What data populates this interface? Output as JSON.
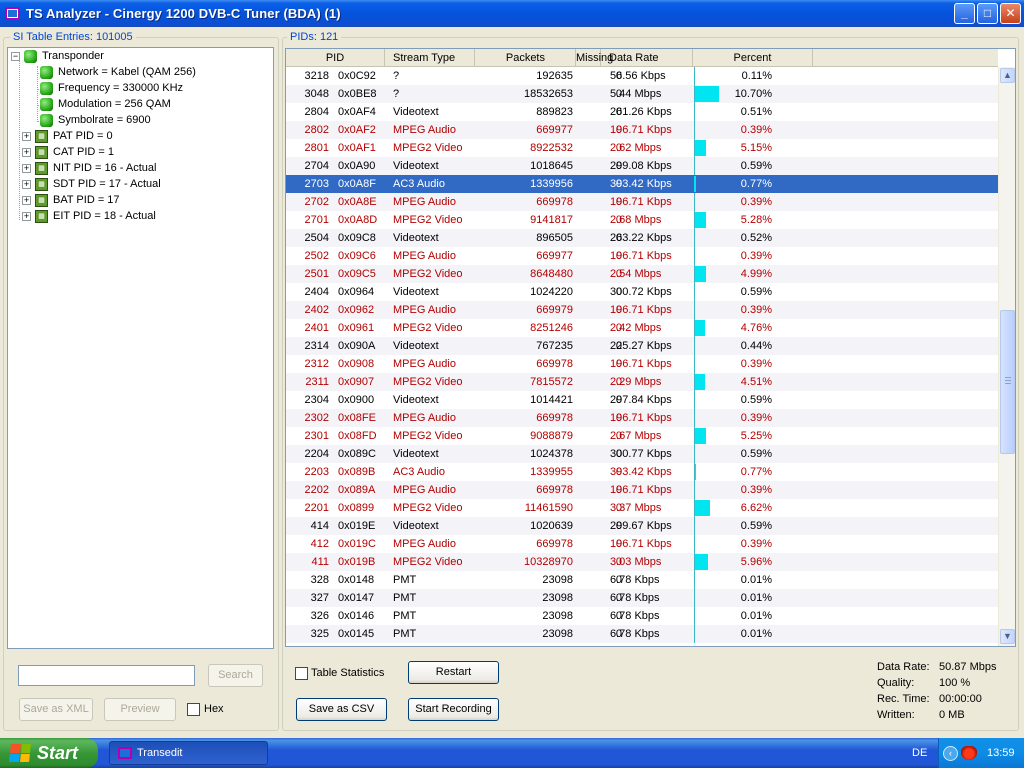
{
  "window": {
    "title": "TS Analyzer - Cinergy 1200 DVB-C Tuner (BDA) (1)",
    "buttons": {
      "minimize": "_",
      "maximize": "□",
      "close": "✕"
    }
  },
  "si_table": {
    "label": "SI Table Entries: 101005",
    "tree": {
      "root": "Transponder",
      "root_children": [
        "Network = Kabel (QAM 256)",
        "Frequency = 330000 KHz",
        "Modulation = 256 QAM",
        "Symbolrate = 6900"
      ],
      "tables": [
        "PAT PID = 0",
        "CAT PID = 1",
        "NIT PID = 16 - Actual",
        "SDT PID = 17 - Actual",
        "BAT PID = 17",
        "EIT PID = 18 - Actual"
      ]
    }
  },
  "pids": {
    "label": "PIDs: 121",
    "columns": [
      "PID",
      "Stream Type",
      "Packets",
      "Missing",
      "Data Rate",
      "Percent"
    ],
    "rows": [
      {
        "pid": "3218",
        "hex": "0x0C92",
        "type": "?",
        "packets": "192635",
        "missing": "0",
        "rate": "56.56 Kbps",
        "percent": "0.11%",
        "bar": 0.11,
        "red": false
      },
      {
        "pid": "3048",
        "hex": "0x0BE8",
        "type": "?",
        "packets": "18532653",
        "missing": "0",
        "rate": "5.44 Mbps",
        "percent": "10.70%",
        "bar": 10.7,
        "red": false
      },
      {
        "pid": "2804",
        "hex": "0x0AF4",
        "type": "Videotext",
        "packets": "889823",
        "missing": "0",
        "rate": "261.26 Kbps",
        "percent": "0.51%",
        "bar": 0.51,
        "red": false
      },
      {
        "pid": "2802",
        "hex": "0x0AF2",
        "type": "MPEG Audio",
        "packets": "669977",
        "missing": "0",
        "rate": "196.71 Kbps",
        "percent": "0.39%",
        "bar": 0.39,
        "red": true
      },
      {
        "pid": "2801",
        "hex": "0x0AF1",
        "type": "MPEG2 Video",
        "packets": "8922532",
        "missing": "0",
        "rate": "2.62 Mbps",
        "percent": "5.15%",
        "bar": 5.15,
        "red": true
      },
      {
        "pid": "2704",
        "hex": "0x0A90",
        "type": "Videotext",
        "packets": "1018645",
        "missing": "0",
        "rate": "299.08 Kbps",
        "percent": "0.59%",
        "bar": 0.59,
        "red": false
      },
      {
        "pid": "2703",
        "hex": "0x0A8F",
        "type": "AC3 Audio",
        "packets": "1339956",
        "missing": "0",
        "rate": "393.42 Kbps",
        "percent": "0.77%",
        "bar": 0.77,
        "red": true,
        "selected": true
      },
      {
        "pid": "2702",
        "hex": "0x0A8E",
        "type": "MPEG Audio",
        "packets": "669978",
        "missing": "0",
        "rate": "196.71 Kbps",
        "percent": "0.39%",
        "bar": 0.39,
        "red": true
      },
      {
        "pid": "2701",
        "hex": "0x0A8D",
        "type": "MPEG2 Video",
        "packets": "9141817",
        "missing": "0",
        "rate": "2.68 Mbps",
        "percent": "5.28%",
        "bar": 5.28,
        "red": true
      },
      {
        "pid": "2504",
        "hex": "0x09C8",
        "type": "Videotext",
        "packets": "896505",
        "missing": "0",
        "rate": "263.22 Kbps",
        "percent": "0.52%",
        "bar": 0.52,
        "red": false
      },
      {
        "pid": "2502",
        "hex": "0x09C6",
        "type": "MPEG Audio",
        "packets": "669977",
        "missing": "0",
        "rate": "196.71 Kbps",
        "percent": "0.39%",
        "bar": 0.39,
        "red": true
      },
      {
        "pid": "2501",
        "hex": "0x09C5",
        "type": "MPEG2 Video",
        "packets": "8648480",
        "missing": "0",
        "rate": "2.54 Mbps",
        "percent": "4.99%",
        "bar": 4.99,
        "red": true
      },
      {
        "pid": "2404",
        "hex": "0x0964",
        "type": "Videotext",
        "packets": "1024220",
        "missing": "0",
        "rate": "300.72 Kbps",
        "percent": "0.59%",
        "bar": 0.59,
        "red": false
      },
      {
        "pid": "2402",
        "hex": "0x0962",
        "type": "MPEG Audio",
        "packets": "669979",
        "missing": "0",
        "rate": "196.71 Kbps",
        "percent": "0.39%",
        "bar": 0.39,
        "red": true
      },
      {
        "pid": "2401",
        "hex": "0x0961",
        "type": "MPEG2 Video",
        "packets": "8251246",
        "missing": "0",
        "rate": "2.42 Mbps",
        "percent": "4.76%",
        "bar": 4.76,
        "red": true
      },
      {
        "pid": "2314",
        "hex": "0x090A",
        "type": "Videotext",
        "packets": "767235",
        "missing": "0",
        "rate": "225.27 Kbps",
        "percent": "0.44%",
        "bar": 0.44,
        "red": false
      },
      {
        "pid": "2312",
        "hex": "0x0908",
        "type": "MPEG Audio",
        "packets": "669978",
        "missing": "0",
        "rate": "196.71 Kbps",
        "percent": "0.39%",
        "bar": 0.39,
        "red": true
      },
      {
        "pid": "2311",
        "hex": "0x0907",
        "type": "MPEG2 Video",
        "packets": "7815572",
        "missing": "0",
        "rate": "2.29 Mbps",
        "percent": "4.51%",
        "bar": 4.51,
        "red": true
      },
      {
        "pid": "2304",
        "hex": "0x0900",
        "type": "Videotext",
        "packets": "1014421",
        "missing": "0",
        "rate": "297.84 Kbps",
        "percent": "0.59%",
        "bar": 0.59,
        "red": false
      },
      {
        "pid": "2302",
        "hex": "0x08FE",
        "type": "MPEG Audio",
        "packets": "669978",
        "missing": "0",
        "rate": "196.71 Kbps",
        "percent": "0.39%",
        "bar": 0.39,
        "red": true
      },
      {
        "pid": "2301",
        "hex": "0x08FD",
        "type": "MPEG2 Video",
        "packets": "9088879",
        "missing": "0",
        "rate": "2.67 Mbps",
        "percent": "5.25%",
        "bar": 5.25,
        "red": true
      },
      {
        "pid": "2204",
        "hex": "0x089C",
        "type": "Videotext",
        "packets": "1024378",
        "missing": "0",
        "rate": "300.77 Kbps",
        "percent": "0.59%",
        "bar": 0.59,
        "red": false
      },
      {
        "pid": "2203",
        "hex": "0x089B",
        "type": "AC3 Audio",
        "packets": "1339955",
        "missing": "0",
        "rate": "393.42 Kbps",
        "percent": "0.77%",
        "bar": 0.77,
        "red": true
      },
      {
        "pid": "2202",
        "hex": "0x089A",
        "type": "MPEG Audio",
        "packets": "669978",
        "missing": "0",
        "rate": "196.71 Kbps",
        "percent": "0.39%",
        "bar": 0.39,
        "red": true
      },
      {
        "pid": "2201",
        "hex": "0x0899",
        "type": "MPEG2 Video",
        "packets": "11461590",
        "missing": "0",
        "rate": "3.37 Mbps",
        "percent": "6.62%",
        "bar": 6.62,
        "red": true
      },
      {
        "pid": "414",
        "hex": "0x019E",
        "type": "Videotext",
        "packets": "1020639",
        "missing": "0",
        "rate": "299.67 Kbps",
        "percent": "0.59%",
        "bar": 0.59,
        "red": false
      },
      {
        "pid": "412",
        "hex": "0x019C",
        "type": "MPEG Audio",
        "packets": "669978",
        "missing": "0",
        "rate": "196.71 Kbps",
        "percent": "0.39%",
        "bar": 0.39,
        "red": true
      },
      {
        "pid": "411",
        "hex": "0x019B",
        "type": "MPEG2 Video",
        "packets": "10328970",
        "missing": "0",
        "rate": "3.03 Mbps",
        "percent": "5.96%",
        "bar": 5.96,
        "red": true
      },
      {
        "pid": "328",
        "hex": "0x0148",
        "type": "PMT",
        "packets": "23098",
        "missing": "0",
        "rate": "6.78 Kbps",
        "percent": "0.01%",
        "bar": 0.01,
        "red": false
      },
      {
        "pid": "327",
        "hex": "0x0147",
        "type": "PMT",
        "packets": "23098",
        "missing": "0",
        "rate": "6.78 Kbps",
        "percent": "0.01%",
        "bar": 0.01,
        "red": false
      },
      {
        "pid": "326",
        "hex": "0x0146",
        "type": "PMT",
        "packets": "23098",
        "missing": "0",
        "rate": "6.78 Kbps",
        "percent": "0.01%",
        "bar": 0.01,
        "red": false
      },
      {
        "pid": "325",
        "hex": "0x0145",
        "type": "PMT",
        "packets": "23098",
        "missing": "0",
        "rate": "6.78 Kbps",
        "percent": "0.01%",
        "bar": 0.01,
        "red": false
      }
    ],
    "bar_color": "#00e5f0",
    "stream_highlight_color": "#b30000",
    "selected_color": "#316ac5"
  },
  "controls": {
    "search_value": "",
    "search_label": "Search",
    "save_xml_label": "Save as XML",
    "preview_label": "Preview",
    "hex_label": "Hex",
    "table_stats_label": "Table Statistics",
    "restart_label": "Restart",
    "save_csv_label": "Save as CSV",
    "start_recording_label": "Start Recording"
  },
  "stats": [
    {
      "key": "Data Rate:",
      "value": "50.87 Mbps"
    },
    {
      "key": "Quality:",
      "value": "100 %"
    },
    {
      "key": "Rec. Time:",
      "value": "00:00:00"
    },
    {
      "key": "Written:",
      "value": "0 MB"
    }
  ],
  "taskbar": {
    "start_label": "Start",
    "task_label": "Transedit",
    "language": "DE",
    "clock": "13:59"
  },
  "icons": {
    "tree_node": "green-status-icon",
    "table_node": "si-table-icon",
    "scroll_up": "▲",
    "scroll_down": "▼",
    "tray_arrow": "‹"
  }
}
